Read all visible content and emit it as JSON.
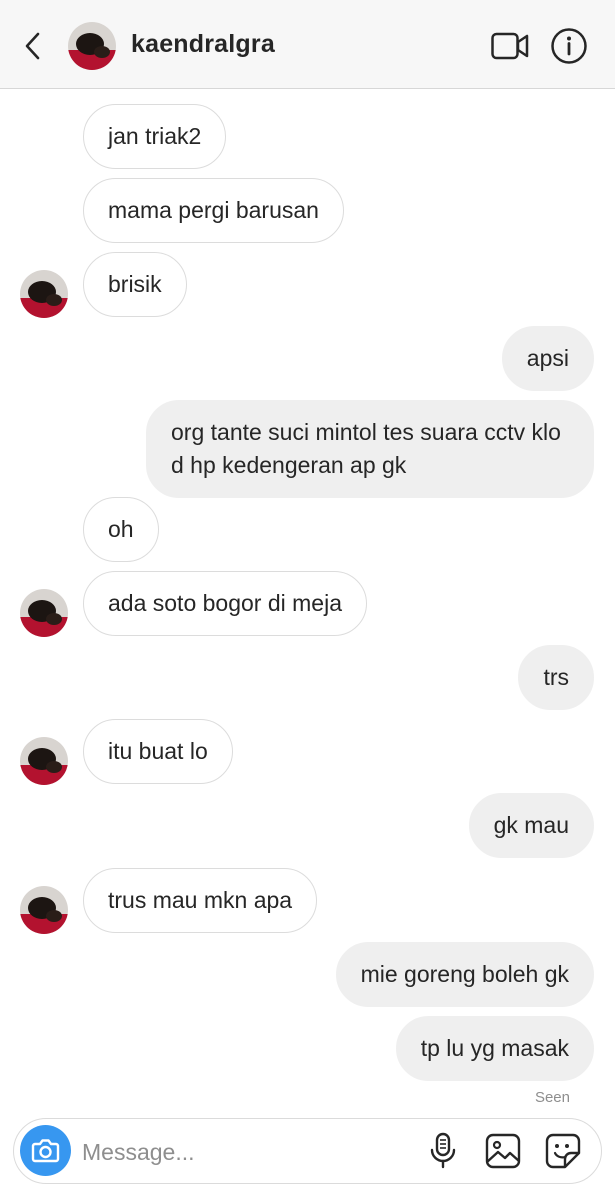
{
  "header": {
    "username": "kaendralgra",
    "back_icon": "chevron-left-icon",
    "video_icon": "video-call-icon",
    "info_icon": "info-icon"
  },
  "messages": [
    {
      "dir": "in",
      "text": "jan triak2",
      "avatar": false
    },
    {
      "dir": "in",
      "text": "mama pergi barusan",
      "avatar": false
    },
    {
      "dir": "in",
      "text": "brisik",
      "avatar": true
    },
    {
      "dir": "out",
      "text": "apsi"
    },
    {
      "dir": "out",
      "text": "org tante suci mintol tes suara cctv klo d hp kedengeran ap gk"
    },
    {
      "dir": "in",
      "text": "oh",
      "avatar": false
    },
    {
      "dir": "in",
      "text": "ada soto bogor di meja",
      "avatar": true
    },
    {
      "dir": "out",
      "text": "trs"
    },
    {
      "dir": "in",
      "text": "itu buat lo",
      "avatar": true
    },
    {
      "dir": "out",
      "text": "gk mau"
    },
    {
      "dir": "in",
      "text": "trus mau mkn apa",
      "avatar": true
    },
    {
      "dir": "out",
      "text": "mie goreng boleh gk"
    },
    {
      "dir": "out",
      "text": "tp lu yg masak"
    }
  ],
  "seen_label": "Seen",
  "composer": {
    "placeholder": "Message...",
    "value": "",
    "camera_icon": "camera-icon",
    "mic_icon": "microphone-icon",
    "gallery_icon": "gallery-icon",
    "sticker_icon": "sticker-icon"
  },
  "colors": {
    "accent": "#3797f0",
    "incoming_border": "#dcdcdc",
    "outgoing_bg": "#efefef",
    "header_bg": "#f7f7f7"
  }
}
